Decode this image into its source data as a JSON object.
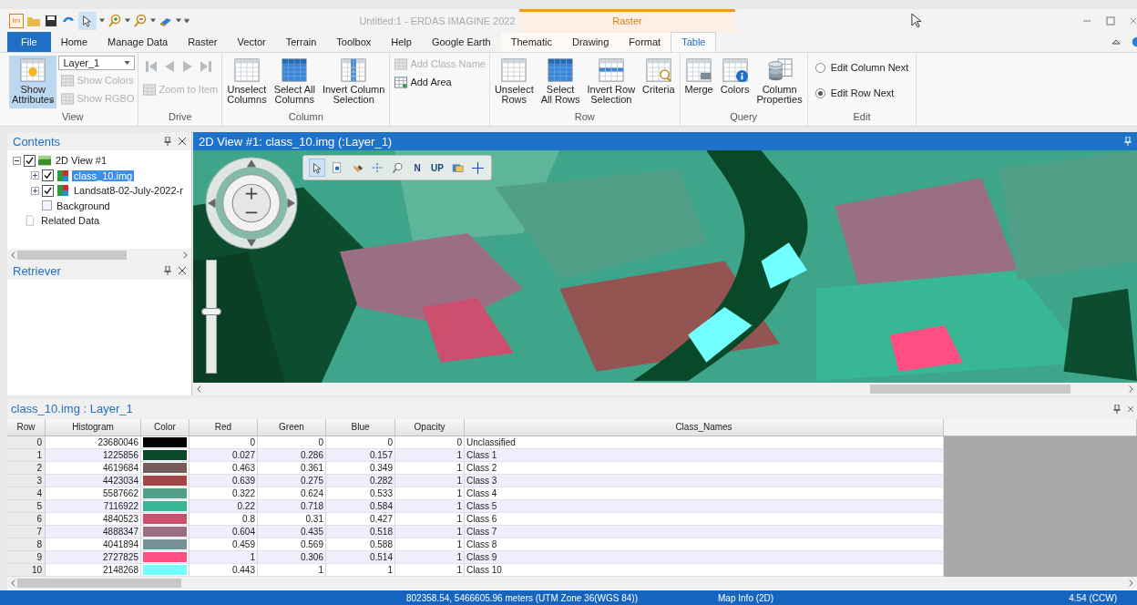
{
  "window": {
    "app_icon_label": "Im",
    "title": "Untitled:1 - ERDAS IMAGINE 2022",
    "context_tab": "Raster"
  },
  "ribbon_tabs": [
    {
      "label": "File",
      "kind": "file",
      "selected": false
    },
    {
      "label": "Home",
      "kind": "tab",
      "selected": false
    },
    {
      "label": "Manage Data",
      "kind": "tab",
      "selected": false
    },
    {
      "label": "Raster",
      "kind": "tab",
      "selected": false
    },
    {
      "label": "Vector",
      "kind": "tab",
      "selected": false
    },
    {
      "label": "Terrain",
      "kind": "tab",
      "selected": false
    },
    {
      "label": "Toolbox",
      "kind": "tab",
      "selected": false
    },
    {
      "label": "Help",
      "kind": "tab",
      "selected": false
    },
    {
      "label": "Google Earth",
      "kind": "tab",
      "selected": false
    },
    {
      "label": "Thematic",
      "kind": "context",
      "selected": false
    },
    {
      "label": "Drawing",
      "kind": "context",
      "selected": false
    },
    {
      "label": "Format",
      "kind": "context",
      "selected": false
    },
    {
      "label": "Table",
      "kind": "context",
      "selected": true
    }
  ],
  "ribbon": {
    "groups": [
      {
        "label": "View",
        "columns": [
          [
            {
              "kind": "large",
              "label": "Show\nAttributes",
              "on": true,
              "disabled": false,
              "dropdown": true
            }
          ],
          [
            {
              "kind": "combo",
              "value": "Layer_1"
            },
            {
              "kind": "small",
              "label": "Show Colors",
              "disabled": true
            },
            {
              "kind": "small",
              "label": "Show RGBO",
              "disabled": true
            }
          ]
        ]
      },
      {
        "label": "Drive",
        "columns": [
          [
            {
              "kind": "nav",
              "disabled": true
            },
            {
              "kind": "small",
              "label": "Zoom to Item",
              "disabled": true
            }
          ]
        ]
      },
      {
        "label": "Column",
        "columns": [
          [
            {
              "kind": "large",
              "label": "Unselect\nColumns",
              "on": false,
              "disabled": false
            }
          ],
          [
            {
              "kind": "large",
              "label": "Select All\nColumns",
              "on": false,
              "disabled": false
            }
          ],
          [
            {
              "kind": "large",
              "label": "Invert Column\nSelection",
              "on": false,
              "disabled": false
            }
          ]
        ]
      },
      {
        "columns": [
          [
            {
              "kind": "small",
              "label": "Add Class Name",
              "disabled": true
            },
            {
              "kind": "small",
              "label": "Add Area",
              "disabled": false
            }
          ]
        ]
      },
      {
        "label": "Row",
        "columns": [
          [
            {
              "kind": "large",
              "label": "Unselect\nRows",
              "on": false,
              "disabled": false
            }
          ],
          [
            {
              "kind": "large",
              "label": "Select\nAll Rows",
              "on": false,
              "disabled": false
            }
          ],
          [
            {
              "kind": "large",
              "label": "Invert Row\nSelection",
              "on": false,
              "disabled": false
            }
          ],
          [
            {
              "kind": "large",
              "label": "Criteria",
              "on": false,
              "disabled": false
            }
          ]
        ]
      },
      {
        "label": "Query",
        "columns": [
          [
            {
              "kind": "large",
              "label": "Merge",
              "on": false,
              "disabled": false
            }
          ],
          [
            {
              "kind": "large",
              "label": "Colors",
              "on": false,
              "disabled": false
            }
          ],
          [
            {
              "kind": "large",
              "label": "Column\nProperties",
              "on": false,
              "disabled": false
            }
          ]
        ]
      },
      {
        "label": "Edit",
        "columns": [
          [
            {
              "kind": "radio",
              "label": "Edit Column Next",
              "selected": false
            },
            {
              "kind": "radio",
              "label": "Edit Row Next",
              "selected": true
            }
          ]
        ]
      }
    ]
  },
  "contents": {
    "title": "Contents",
    "items": [
      {
        "kind": "view",
        "label": "2D View #1",
        "checked": true,
        "expanded": true,
        "selected": false,
        "children": [
          {
            "kind": "layer",
            "label": "class_10.img",
            "checked": true,
            "expanded": false,
            "selected": true
          },
          {
            "kind": "layer",
            "label": "Landsat8-02-July-2022-r",
            "checked": true,
            "expanded": false,
            "selected": false
          },
          {
            "kind": "background",
            "label": "Background",
            "selected": false
          }
        ]
      },
      {
        "kind": "data",
        "label": "Related Data",
        "selected": false
      }
    ]
  },
  "retriever": {
    "title": "Retriever"
  },
  "map_view": {
    "title": "2D View #1: class_10.img (:Layer_1)",
    "tools": [
      {
        "kind": "select",
        "selected": true
      },
      {
        "kind": "info",
        "selected": false
      },
      {
        "kind": "pan",
        "selected": false
      },
      {
        "kind": "fit",
        "selected": false
      },
      {
        "kind": "zoom",
        "selected": false
      },
      {
        "kind": "north",
        "label": "N",
        "selected": false
      },
      {
        "kind": "up",
        "label": "UP",
        "selected": false
      },
      {
        "kind": "layers",
        "selected": false
      },
      {
        "kind": "cross",
        "selected": false
      }
    ],
    "zoom_slider": {
      "level": 0.55
    }
  },
  "attribute_table": {
    "title": "class_10.img : Layer_1",
    "columns": [
      "Row",
      "Histogram",
      "Color",
      "Red",
      "Green",
      "Blue",
      "Opacity",
      "Class_Names"
    ],
    "rows": [
      {
        "row": "0",
        "histogram": "23680046",
        "color": "#000000",
        "red": "0",
        "green": "0",
        "blue": "0",
        "opacity": "0",
        "class_name": "Unclassified"
      },
      {
        "row": "1",
        "histogram": "1225856",
        "color": "#074928",
        "red": "0.027",
        "green": "0.286",
        "blue": "0.157",
        "opacity": "1",
        "class_name": "Class 1"
      },
      {
        "row": "2",
        "histogram": "4619684",
        "color": "#765c59",
        "red": "0.463",
        "green": "0.361",
        "blue": "0.349",
        "opacity": "1",
        "class_name": "Class 2"
      },
      {
        "row": "3",
        "histogram": "4423034",
        "color": "#a34648",
        "red": "0.639",
        "green": "0.275",
        "blue": "0.282",
        "opacity": "1",
        "class_name": "Class 3"
      },
      {
        "row": "4",
        "histogram": "5587662",
        "color": "#529f88",
        "red": "0.322",
        "green": "0.624",
        "blue": "0.533",
        "opacity": "1",
        "class_name": "Class 4"
      },
      {
        "row": "5",
        "histogram": "7116922",
        "color": "#38b795",
        "red": "0.22",
        "green": "0.718",
        "blue": "0.584",
        "opacity": "1",
        "class_name": "Class 5"
      },
      {
        "row": "6",
        "histogram": "4840523",
        "color": "#cc4f6d",
        "red": "0.8",
        "green": "0.31",
        "blue": "0.427",
        "opacity": "1",
        "class_name": "Class 6"
      },
      {
        "row": "7",
        "histogram": "4888347",
        "color": "#9a6f84",
        "red": "0.604",
        "green": "0.435",
        "blue": "0.518",
        "opacity": "1",
        "class_name": "Class 7"
      },
      {
        "row": "8",
        "histogram": "4041894",
        "color": "#759196",
        "red": "0.459",
        "green": "0.569",
        "blue": "0.588",
        "opacity": "1",
        "class_name": "Class 8"
      },
      {
        "row": "9",
        "histogram": "2727825",
        "color": "#ff4e83",
        "red": "1",
        "green": "0.306",
        "blue": "0.514",
        "opacity": "1",
        "class_name": "Class 9"
      },
      {
        "row": "10",
        "histogram": "2148268",
        "color": "#71ffff",
        "red": "0.443",
        "green": "1",
        "blue": "1",
        "opacity": "1",
        "class_name": "Class 10"
      }
    ]
  },
  "status_bar": {
    "coordinates": "802358.54, 5466605.96 meters (UTM Zone 36(WGS 84))",
    "map_info": "Map Info (2D)",
    "rotation": "4.54 (CCW)"
  }
}
